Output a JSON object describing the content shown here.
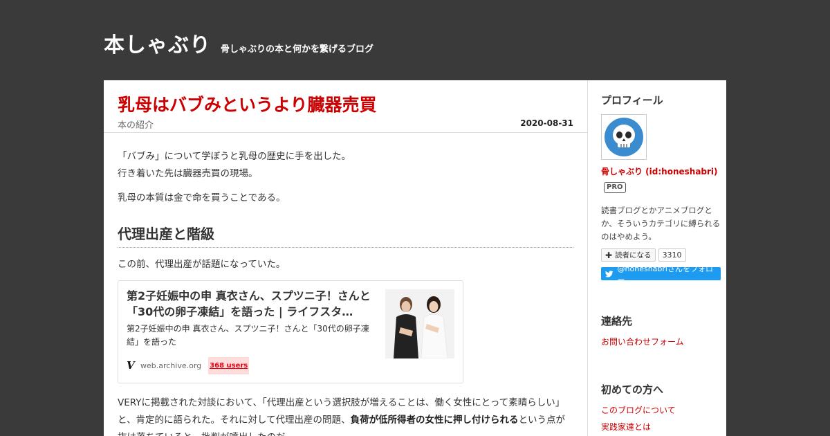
{
  "blog": {
    "title": "本しゃぶり",
    "description": "骨しゃぶりの本と何かを繋げるブログ"
  },
  "entry": {
    "title": "乳母はバブみというより臓器売買",
    "category": "本の紹介",
    "date": "2020-08-31",
    "intro_line1": "「バブみ」について学ぼうと乳母の歴史に手を出した。",
    "intro_line2": "行き着いた先は臓器売買の現場。",
    "intro_p2": "乳母の本質は金で命を買うことである。",
    "heading1": "代理出産と階級",
    "p_before_card": "この前、代理出産が話題になっていた。",
    "card": {
      "title": "第2子妊娠中の申 真衣さん、スプツニ子！さんと「30代の卵子凍結」を語った | ライフスタ…",
      "description": "第2子妊娠中の申 真衣さん、スプツニ子！さんと「30代の卵子凍結」を語った",
      "site_icon": "V",
      "domain": "web.archive.org",
      "users": "368 users"
    },
    "p_after_card_1": "VERYに掲載された対談において、「代理出産という選択肢が増えることは、働く女性にとって素晴らしい」と、肯定的に語られた。それに対して代理出産の問題、",
    "p_after_card_bold": "負荷が低所得者の女性に押し付けられる",
    "p_after_card_2": "という点が抜け落ちていると、批判が噴出したのだ。"
  },
  "sidebar": {
    "profile_title": "プロフィール",
    "profile_id": "骨しゃぶり (id:honeshabri)",
    "pro_label": "PRO",
    "profile_desc": "読書ブログとかアニメブログとか、そういうカテゴリに縛られるのはやめよう。",
    "reader_button": "読者になる",
    "reader_count": "3310",
    "twitter_follow": "@honeshabriさんをフォロー",
    "contact_title": "連絡先",
    "contact_link": "お問い合わせフォーム",
    "first_title": "初めての方へ",
    "first_link_1": "このブログについて",
    "first_link_2": "実践家達とは"
  },
  "colors": {
    "header_bg": "#3a3a3a",
    "accent_red": "#cc0000",
    "twitter_blue": "#1d9bf0",
    "avatar_blue": "#3a8ccf"
  }
}
